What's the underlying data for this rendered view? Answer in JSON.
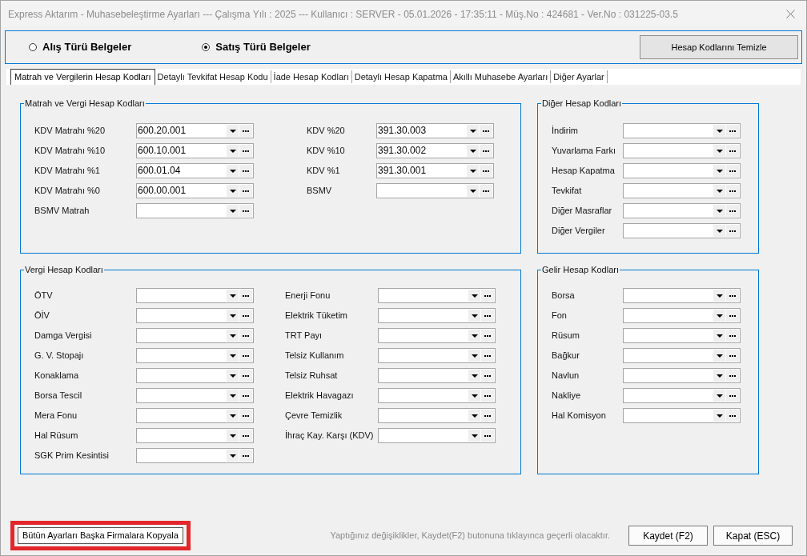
{
  "window": {
    "title": "Express Aktarım - Muhasebeleştirme Ayarları --- Çalışma Yılı : 2025 --- Kullanıcı : SERVER - 05.01.2026 - 17:35:11 - Müş.No : 424681 - Ver.No : 031225-03.5"
  },
  "document_type": {
    "options": [
      {
        "label": "Alış Türü Belgeler",
        "selected": false
      },
      {
        "label": "Satış Türü Belgeler",
        "selected": true
      }
    ],
    "clear_button": "Hesap Kodlarını Temizle"
  },
  "tabs": [
    {
      "label": "Matrah ve Vergilerin Hesap Kodları",
      "selected": true
    },
    {
      "label": "Detaylı Tevkifat Hesap Kodu",
      "selected": false
    },
    {
      "label": "İade Hesap Kodları",
      "selected": false
    },
    {
      "label": "Detaylı Hesap Kapatma",
      "selected": false
    },
    {
      "label": "Akıllı Muhasebe Ayarları",
      "selected": false
    },
    {
      "label": "Diğer Ayarlar",
      "selected": false
    }
  ],
  "groups": [
    {
      "title": "Matrah ve Vergi Hesap Kodları",
      "columns": [
        [
          {
            "label": "KDV Matrahı %20",
            "value": "600.20.001"
          },
          {
            "label": "KDV Matrahı %10",
            "value": "600.10.001"
          },
          {
            "label": "KDV Matrahı %1",
            "value": "600.01.04"
          },
          {
            "label": "KDV Matrahı %0",
            "value": "600.00.001"
          },
          {
            "label": "BSMV Matrah"
          }
        ],
        [
          {
            "label": "KDV %20",
            "value": "391.30.003"
          },
          {
            "label": "KDV %10",
            "value": "391.30.002"
          },
          {
            "label": "KDV %1",
            "value": "391.30.001"
          },
          {
            "label": "BSMV"
          }
        ]
      ]
    },
    {
      "title": "Diğer Hesap Kodları",
      "columns": [
        [
          {
            "label": "İndirim"
          },
          {
            "label": "Yuvarlama Farkı"
          },
          {
            "label": "Hesap Kapatma"
          },
          {
            "label": "Tevkifat"
          },
          {
            "label": "Diğer Masraflar"
          },
          {
            "label": "Diğer Vergiler"
          }
        ]
      ]
    },
    {
      "title": "Vergi Hesap Kodları",
      "columns": [
        [
          {
            "label": "ÖTV"
          },
          {
            "label": "ÖİV"
          },
          {
            "label": "Damga Vergisi"
          },
          {
            "label": "G. V. Stopajı"
          },
          {
            "label": "Konaklama"
          },
          {
            "label": "Borsa Tescil"
          },
          {
            "label": "Mera Fonu"
          },
          {
            "label": "Hal Rüsum"
          },
          {
            "label": "SGK Prim Kesintisi"
          }
        ],
        [
          {
            "label": "Enerji Fonu"
          },
          {
            "label": "Elektrik Tüketim"
          },
          {
            "label": "TRT Payı"
          },
          {
            "label": "Telsiz Kullanım"
          },
          {
            "label": "Telsiz Ruhsat"
          },
          {
            "label": "Elektrik Havagazı"
          },
          {
            "label": "Çevre Temizlik"
          },
          {
            "label": "İhraç Kay. Karşı (KDV)"
          }
        ]
      ]
    },
    {
      "title": "Gelir Hesap Kodları",
      "columns": [
        [
          {
            "label": "Borsa"
          },
          {
            "label": "Fon"
          },
          {
            "label": "Rüsum"
          },
          {
            "label": "Bağkur"
          },
          {
            "label": "Navlun"
          },
          {
            "label": "Nakliye"
          },
          {
            "label": "Hal Komisyon"
          }
        ]
      ]
    }
  ],
  "footer": {
    "copy_button": {
      "label": "Bütün Ayarları Başka Firmalara Kopyala",
      "highlighted": true
    },
    "hint": "Yaptığınız değişiklikler, Kaydet(F2) butonuna tıklayınca geçerli olacaktır.",
    "buttons": [
      "Kaydet (F2)",
      "Kapat (ESC)"
    ]
  }
}
